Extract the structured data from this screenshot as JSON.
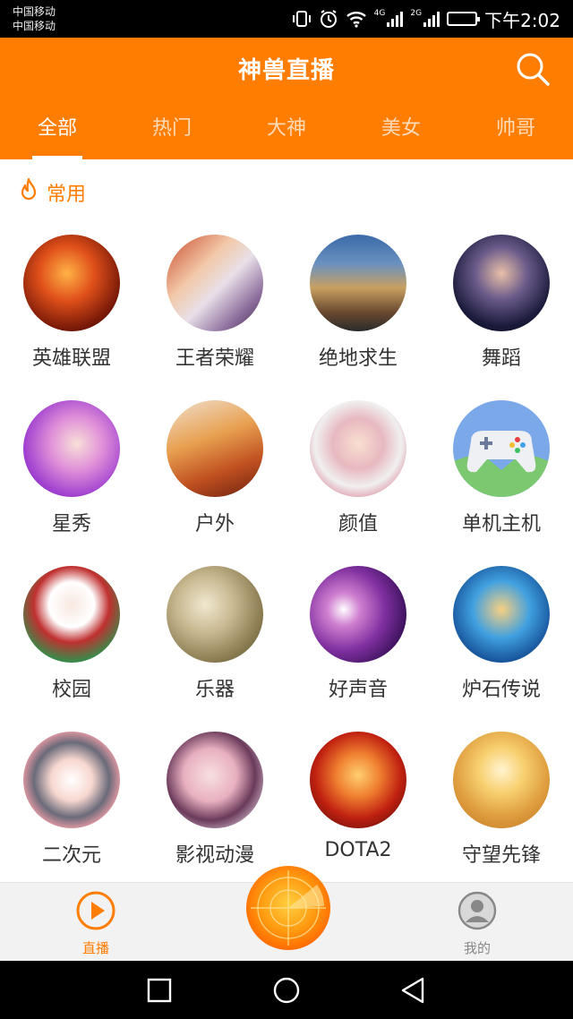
{
  "status_bar": {
    "carrier_1": "中国移动",
    "carrier_2": "中国移动",
    "network_1": "4G",
    "network_2": "2G",
    "time": "下午2:02",
    "battery_level": 0.78
  },
  "header": {
    "title": "神兽直播",
    "search_icon": "search-icon"
  },
  "tabs": [
    {
      "label": "全部",
      "active": true
    },
    {
      "label": "热门",
      "active": false
    },
    {
      "label": "大神",
      "active": false
    },
    {
      "label": "美女",
      "active": false
    },
    {
      "label": "帅哥",
      "active": false
    }
  ],
  "section": {
    "icon": "flame-icon",
    "title": "常用"
  },
  "categories": [
    {
      "label": "英雄联盟"
    },
    {
      "label": "王者荣耀"
    },
    {
      "label": "绝地求生"
    },
    {
      "label": "舞蹈"
    },
    {
      "label": "星秀"
    },
    {
      "label": "户外"
    },
    {
      "label": "颜值"
    },
    {
      "label": "单机主机"
    },
    {
      "label": "校园"
    },
    {
      "label": "乐器"
    },
    {
      "label": "好声音"
    },
    {
      "label": "炉石传说"
    },
    {
      "label": "二次元"
    },
    {
      "label": "影视动漫"
    },
    {
      "label": "DOTA2"
    },
    {
      "label": "守望先锋"
    }
  ],
  "bottom_nav": {
    "live_label": "直播",
    "mine_label": "我的",
    "center_icon": "radar-icon"
  },
  "colors": {
    "accent": "#ff7d00",
    "inactive": "#888888"
  }
}
